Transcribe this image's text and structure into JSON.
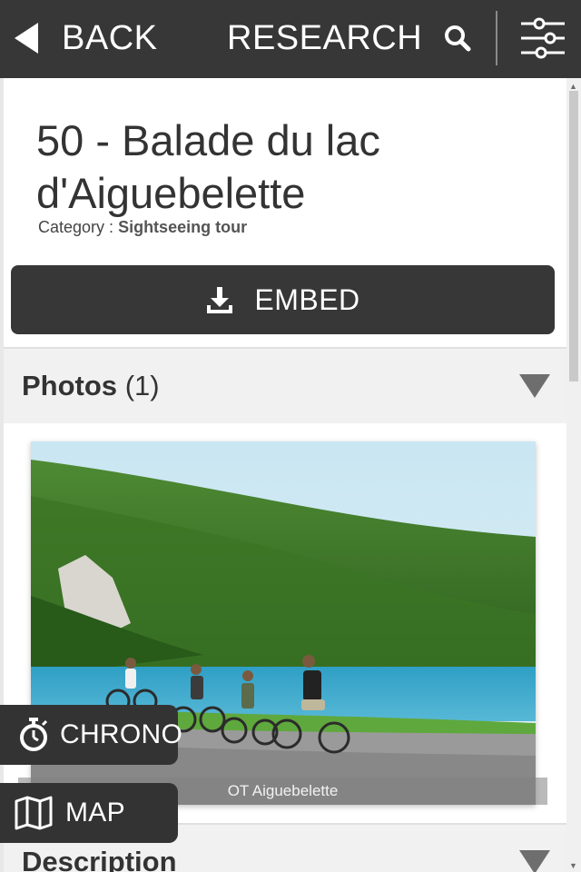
{
  "topbar": {
    "back_label": "BACK",
    "research_label": "RESEARCH",
    "back_icon": "triangle-left-icon",
    "search_icon": "search-icon",
    "filter_icon": "sliders-icon"
  },
  "poi": {
    "title": "50 - Balade du lac d'Aiguebelette",
    "category_label": "Category :",
    "category_value": "Sightseeing tour"
  },
  "embed": {
    "label": "EMBED",
    "icon": "download-icon"
  },
  "photos_section": {
    "title": "Photos",
    "count": "(1)",
    "caption": "OT Aiguebelette"
  },
  "description_section": {
    "title": "Description"
  },
  "floating": {
    "chrono_label": "CHRONO",
    "chrono_icon": "stopwatch-icon",
    "map_label": "MAP",
    "map_icon": "folded-map-icon"
  },
  "colors": {
    "topbar_bg": "#373737",
    "button_bg": "#373737",
    "section_bg": "#f1f1f1",
    "chevron": "#6e6e6e"
  }
}
